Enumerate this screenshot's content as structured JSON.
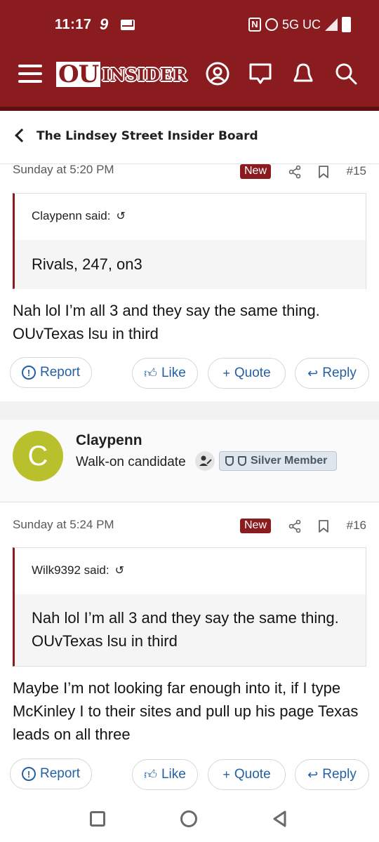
{
  "status_bar": {
    "time": "11:17",
    "carrier_badge": "9",
    "network": "5G UC"
  },
  "header": {
    "logo_ou": "OU",
    "logo_insider": "INSIDER"
  },
  "breadcrumb": {
    "label": "The Lindsey Street Insider Board"
  },
  "posts": [
    {
      "date": "Sunday at 5:20 PM",
      "badge": "New",
      "number": "#15",
      "quote_author": "Claypenn said:",
      "quote_text": "Rivals, 247, on3",
      "body": "Nah lol I’m all 3 and they say the same thing. OUvTexas lsu in third",
      "actions": {
        "report": "Report",
        "like": "Like",
        "quote": "Quote",
        "reply": "Reply"
      }
    },
    {
      "date": "Sunday at 5:24 PM",
      "badge": "New",
      "number": "#16",
      "quote_author": "Wilk9392 said:",
      "quote_text": "Nah lol I’m all 3 and they say the same thing. OUvTexas lsu in third",
      "body": "Maybe I’m not looking far enough into it, if I type McKinley I to their sites and pull up his page Texas leads on all three",
      "actions": {
        "report": "Report",
        "like": "Like",
        "quote": "Quote",
        "reply": "Reply"
      }
    }
  ],
  "user": {
    "avatar_letter": "C",
    "avatar_color": "#b8c12c",
    "name": "Claypenn",
    "title": "Walk-on candidate",
    "badge": "Silver Member"
  },
  "colors": {
    "brand": "#8a1b1f",
    "link": "#2360a5"
  }
}
